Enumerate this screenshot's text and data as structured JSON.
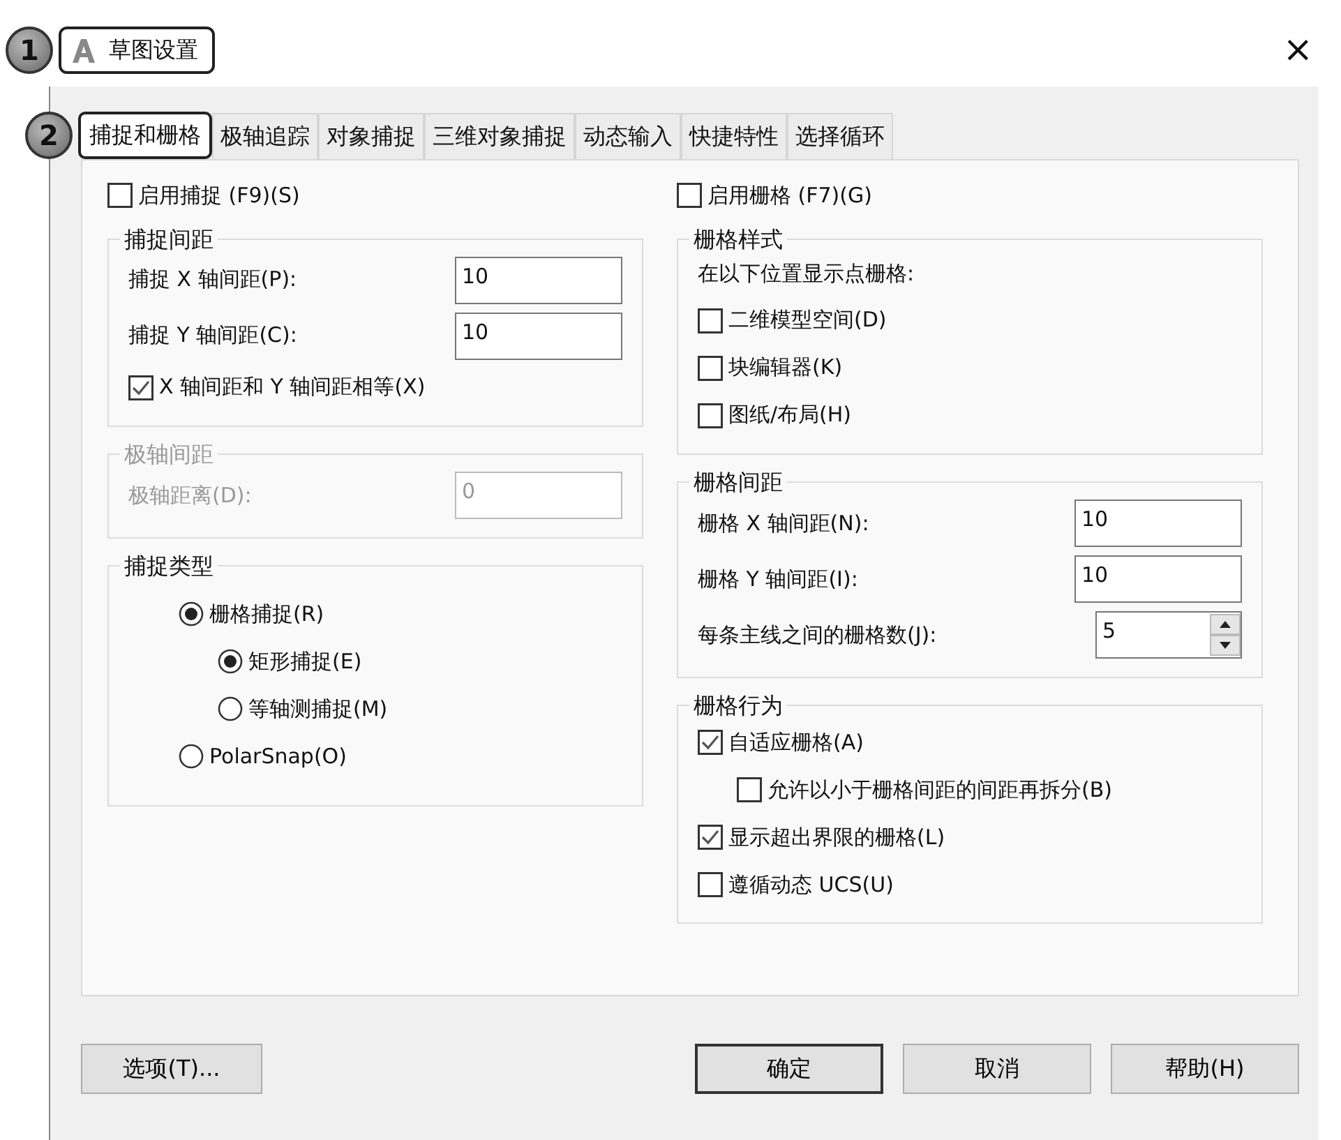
{
  "window": {
    "callout": "1",
    "title": "草图设置",
    "close": "×"
  },
  "tabs_callout": "2",
  "tabs": [
    {
      "label": "捕捉和栅格",
      "selected": true
    },
    {
      "label": "极轴追踪",
      "selected": false
    },
    {
      "label": "对象捕捉",
      "selected": false
    },
    {
      "label": "三维对象捕捉",
      "selected": false
    },
    {
      "label": "动态输入",
      "selected": false
    },
    {
      "label": "快捷特性",
      "selected": false
    },
    {
      "label": "选择循环",
      "selected": false
    }
  ],
  "columns": [
    {
      "toggle": {
        "label": "启用捕捉 (F9)(S)",
        "checked": false
      },
      "groups": [
        {
          "title": "捕捉间距",
          "disabled": false,
          "items": [
            {
              "kind": "field",
              "label": "捕捉 X 轴间距(P):",
              "value": "10"
            },
            {
              "kind": "field",
              "label": "捕捉 Y 轴间距(C):",
              "value": "10"
            },
            {
              "kind": "checkbox",
              "label": "X 轴间距和 Y 轴间距相等(X)",
              "checked": true
            }
          ]
        },
        {
          "title": "极轴间距",
          "disabled": true,
          "items": [
            {
              "kind": "field",
              "label": "极轴距离(D):",
              "value": "0"
            }
          ]
        },
        {
          "title": "捕捉类型",
          "disabled": false,
          "items": [
            {
              "kind": "radio",
              "label": "栅格捕捉(R)",
              "selected": true,
              "children": [
                {
                  "kind": "radio",
                  "label": "矩形捕捉(E)",
                  "selected": true
                },
                {
                  "kind": "radio",
                  "label": "等轴测捕捉(M)",
                  "selected": false
                }
              ]
            },
            {
              "kind": "radio",
              "label": "PolarSnap(O)",
              "selected": false
            }
          ]
        }
      ]
    },
    {
      "toggle": {
        "label": "启用栅格 (F7)(G)",
        "checked": false
      },
      "groups": [
        {
          "title": "栅格样式",
          "disabled": false,
          "items": [
            {
              "kind": "text",
              "label": "在以下位置显示点栅格:"
            },
            {
              "kind": "checkbox",
              "label": "二维模型空间(D)",
              "checked": false
            },
            {
              "kind": "checkbox",
              "label": "块编辑器(K)",
              "checked": false
            },
            {
              "kind": "checkbox",
              "label": "图纸/布局(H)",
              "checked": false
            }
          ]
        },
        {
          "title": "栅格间距",
          "disabled": false,
          "items": [
            {
              "kind": "field",
              "label": "栅格 X 轴间距(N):",
              "value": "10"
            },
            {
              "kind": "field",
              "label": "栅格 Y 轴间距(I):",
              "value": "10"
            },
            {
              "kind": "spinner",
              "label": "每条主线之间的栅格数(J):",
              "value": "5"
            }
          ]
        },
        {
          "title": "栅格行为",
          "disabled": false,
          "items": [
            {
              "kind": "checkbox",
              "label": "自适应栅格(A)",
              "checked": true,
              "children": [
                {
                  "kind": "checkbox",
                  "label": "允许以小于栅格间距的间距再拆分(B)",
                  "checked": false
                }
              ]
            },
            {
              "kind": "checkbox",
              "label": "显示超出界限的栅格(L)",
              "checked": true
            },
            {
              "kind": "checkbox",
              "label": "遵循动态 UCS(U)",
              "checked": false
            }
          ]
        }
      ]
    }
  ],
  "buttons": [
    {
      "label": "选项(T)...",
      "default": false
    },
    {
      "label": "确定",
      "default": true
    },
    {
      "label": "取消",
      "default": false
    },
    {
      "label": "帮助(H)",
      "default": false
    }
  ]
}
